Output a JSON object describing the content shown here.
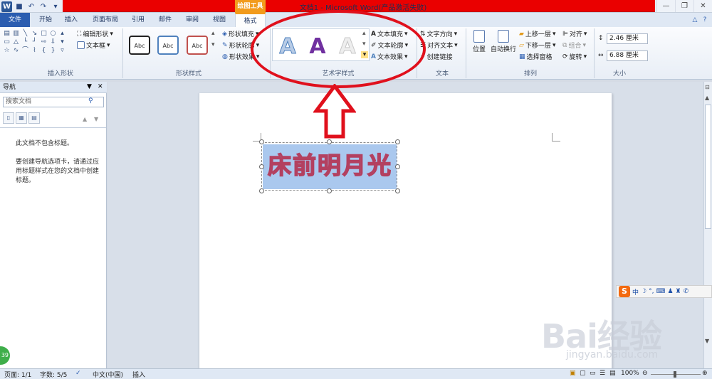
{
  "window": {
    "title": "文档1 - Microsoft Word(产品激活失败)",
    "context_tab_header": "绘图工具",
    "minimize": "—",
    "restore": "❐",
    "close": "✕"
  },
  "tabs": [
    {
      "label": "文件"
    },
    {
      "label": "开始"
    },
    {
      "label": "插入"
    },
    {
      "label": "页面布局"
    },
    {
      "label": "引用"
    },
    {
      "label": "邮件"
    },
    {
      "label": "审阅"
    },
    {
      "label": "视图"
    },
    {
      "label": "格式"
    }
  ],
  "ribbon": {
    "insert_shapes": {
      "label": "插入形状",
      "edit_shape": "编辑形状",
      "text_box": "文本框"
    },
    "shape_styles": {
      "label": "形状样式",
      "preset": "Abc",
      "fill": "形状填充",
      "outline": "形状轮廓",
      "effects": "形状效果"
    },
    "wordart_styles": {
      "label": "艺术字样式",
      "letter": "A",
      "text_fill": "文本填充",
      "text_outline": "文本轮廓",
      "text_effects": "文本效果"
    },
    "text": {
      "label": "文本",
      "direction": "文字方向",
      "align": "对齐文本",
      "link": "创建链接"
    },
    "arrange": {
      "label": "排列",
      "position": "位置",
      "wrap": "自动换行",
      "bring_forward": "上移一层",
      "send_backward": "下移一层",
      "selection_pane": "选择窗格",
      "align": "对齐",
      "group": "组合",
      "rotate": "旋转"
    },
    "size": {
      "label": "大小",
      "height": "2.46 厘米",
      "width": "6.88 厘米"
    }
  },
  "nav": {
    "title": "导航",
    "search_placeholder": "搜索文档",
    "msg1": "此文档不包含标题。",
    "msg2": "要创建导航选项卡，请通过应用标题样式在您的文档中创建标题。"
  },
  "document": {
    "wordart_text": "床前明月光"
  },
  "status": {
    "page": "页面: 1/1",
    "words": "字数: 5/5",
    "language": "中文(中国)",
    "mode": "插入",
    "zoom": "100%"
  },
  "ime": {
    "lang": "中"
  },
  "watermark": {
    "logo": "Bai经验",
    "url": "jingyan.baidu.com"
  },
  "badge": "39",
  "colors": {
    "title_red": "#ea0000",
    "context_orange": "#f29b1c",
    "file_tab": "#2b5db0",
    "highlight_ellipse": "#e0101c",
    "wordart_outline": "#b34060",
    "wordart_fill": "#a8c4ea"
  }
}
